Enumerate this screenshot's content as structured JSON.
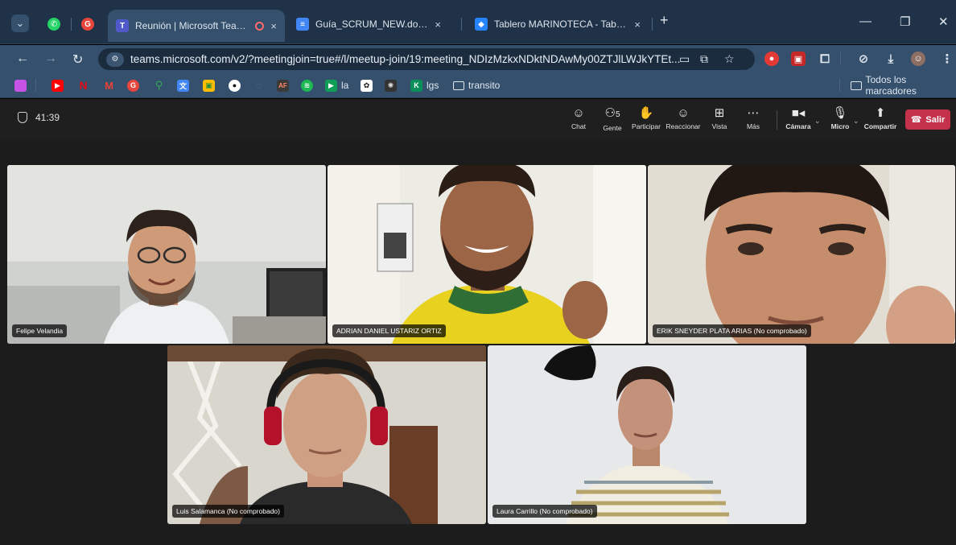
{
  "browser": {
    "tabs": [
      {
        "title": "",
        "icon": "whatsapp-icon"
      },
      {
        "title": "",
        "icon": "chrome-app-icon"
      },
      {
        "title": "Reunión | Microsoft Teams",
        "icon": "teams-icon",
        "active": true
      },
      {
        "title": "Guía_SCRUM_NEW.docx - Docu",
        "icon": "google-docs-icon"
      },
      {
        "title": "Tablero MARINOTECA - Tablero",
        "icon": "jira-icon"
      }
    ],
    "close_glyph": "×",
    "new_tab_glyph": "+",
    "url": "teams.microsoft.com/v2/?meetingjoin=true#/l/meetup-join/19:meeting_NDIzMzkxNDktNDAwMy00ZTJlLWJkYTEt..."
  },
  "bookmarks": {
    "items": [
      {
        "label": "",
        "icon": "app-icon"
      },
      {
        "label": "",
        "icon": "youtube-icon"
      },
      {
        "label": "",
        "icon": "netflix-icon"
      },
      {
        "label": "",
        "icon": "gmail-icon"
      },
      {
        "label": "",
        "icon": "chrome-icon"
      },
      {
        "label": "",
        "icon": "maps-icon"
      },
      {
        "label": "",
        "icon": "translate-icon"
      },
      {
        "label": "",
        "icon": "classroom-icon"
      },
      {
        "label": "",
        "icon": "github-icon"
      },
      {
        "label": "",
        "icon": "link-icon"
      },
      {
        "label": "",
        "icon": "af-icon"
      },
      {
        "label": "",
        "icon": "spotify-icon"
      },
      {
        "label": "la",
        "icon": "sheet-icon"
      },
      {
        "label": "",
        "icon": "openai-icon"
      },
      {
        "label": "",
        "icon": "pattern-icon"
      },
      {
        "label": "lgs",
        "icon": "k-icon"
      },
      {
        "label": "transito",
        "icon": "folder-icon"
      }
    ],
    "all_bookmarks_label": "Todos los marcadores"
  },
  "meeting": {
    "elapsed": "41:39",
    "controls": {
      "chat": "Chat",
      "people": "Gente",
      "people_count": "5",
      "raise": "Participar",
      "react": "Reaccionar",
      "view": "Vista",
      "more": "Más",
      "camera": "Cámara",
      "mic": "Micro",
      "share": "Compartir",
      "leave": "Salir"
    },
    "participants": [
      {
        "name": "Felipe Velandia"
      },
      {
        "name": "ADRIAN DANIEL USTARIZ ORTIZ"
      },
      {
        "name": "ERIK SNEYDER PLATA ARIAS (No comprobado)"
      },
      {
        "name": "Luis Salamanca (No comprobado)"
      },
      {
        "name": "Laura Carrillo (No comprobado)"
      }
    ],
    "colors": {
      "leave": "#c4314b",
      "stage": "#1c1c1c",
      "header": "#1f1f1f"
    }
  }
}
